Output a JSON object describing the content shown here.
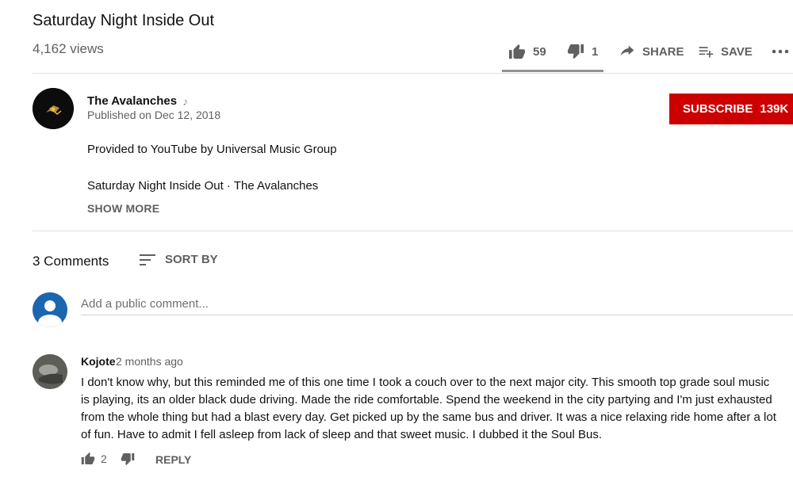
{
  "video": {
    "title": "Saturday Night Inside Out",
    "views": "4,162 views"
  },
  "actions": {
    "likes": "59",
    "dislikes": "1",
    "share_label": "SHARE",
    "save_label": "SAVE",
    "like_ratio": 0.98
  },
  "owner": {
    "name": "The Avalanches",
    "published": "Published on Dec 12, 2018",
    "subscribe_label": "SUBSCRIBE",
    "subscriber_count": "139K"
  },
  "description": {
    "line1": "Provided to YouTube by Universal Music Group",
    "line2": "Saturday Night Inside Out · The Avalanches",
    "show_more_label": "SHOW MORE"
  },
  "comments": {
    "count_label": "3 Comments",
    "sort_label": "SORT BY",
    "add_placeholder": "Add a public comment...",
    "items": [
      {
        "author": "Kojote",
        "time": "2 months ago",
        "text": "I don't know why, but this reminded me of this one time I took a couch over to the next major city. This smooth top grade soul music is playing, its an older black dude driving. Made the ride comfortable. Spend the weekend in the city partying and I'm just exhausted from the whole thing but had a blast every day. Get picked up by the same bus and driver. It was a nice relaxing ride home after a lot of fun. Have to admit I fell asleep from lack of sleep and that sweet music. I dubbed it the Soul Bus.",
        "likes": "2",
        "reply_label": "REPLY"
      }
    ]
  },
  "colors": {
    "subscribe": "#cc0000",
    "secondary_text": "#606060",
    "user_avatar": "#1b66b1"
  }
}
